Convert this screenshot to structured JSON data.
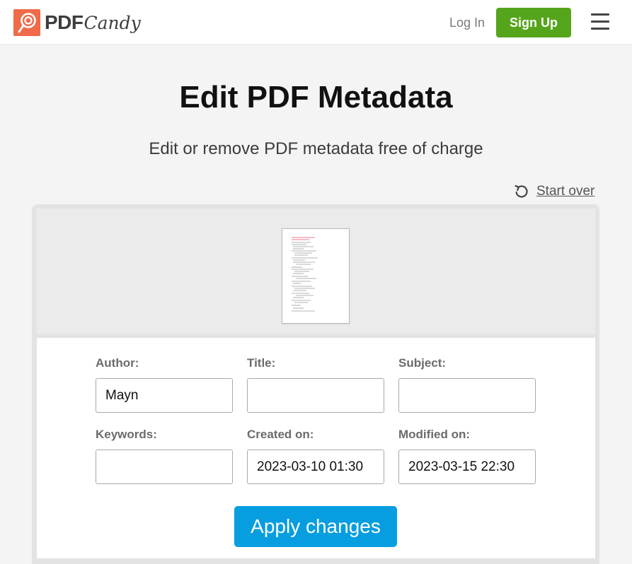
{
  "header": {
    "logo_pdf": "PDF",
    "logo_candy": "Candy",
    "login_label": "Log In",
    "signup_label": "Sign Up",
    "menu_icon": "hamburger-menu-icon"
  },
  "main": {
    "title": "Edit PDF Metadata",
    "subtitle": "Edit or remove PDF metadata free of charge",
    "start_over_label": "Start over",
    "start_over_icon": "rotate-ccw-icon"
  },
  "form": {
    "author": {
      "label": "Author:",
      "value": "Mayn"
    },
    "title": {
      "label": "Title:",
      "value": ""
    },
    "subject": {
      "label": "Subject:",
      "value": ""
    },
    "keywords": {
      "label": "Keywords:",
      "value": ""
    },
    "created": {
      "label": "Created on:",
      "value": "2023-03-10 01:30"
    },
    "modified": {
      "label": "Modified on:",
      "value": "2023-03-15 22:30"
    },
    "apply_label": "Apply changes"
  },
  "colors": {
    "brand": "#ef6b4a",
    "signup": "#55a51c",
    "apply": "#069ee0"
  }
}
